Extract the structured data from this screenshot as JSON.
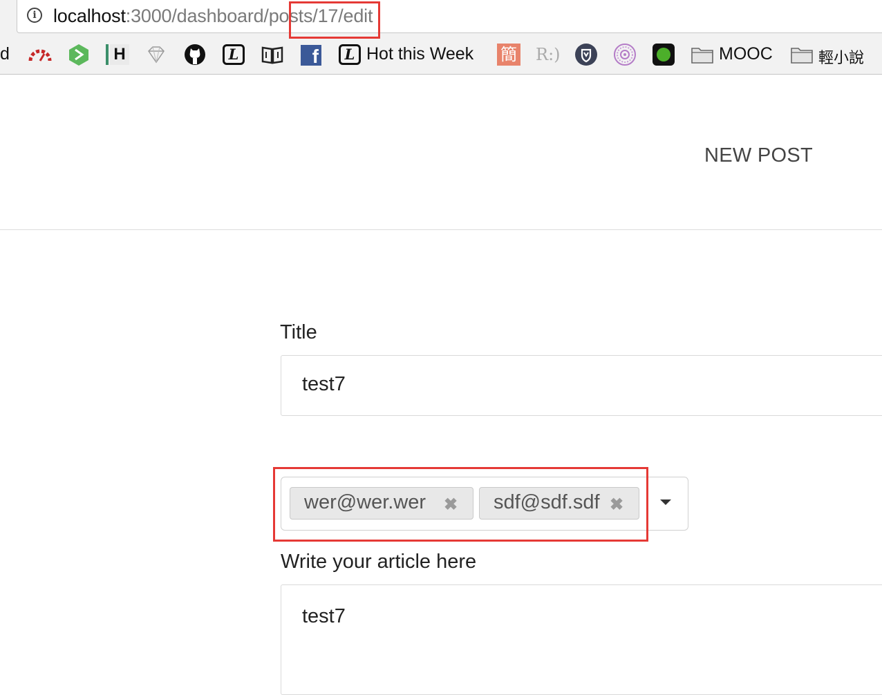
{
  "browser": {
    "url_host": "localhost",
    "url_path": ":3000/dashboard/posts/17/edit",
    "bookmarks": [
      {
        "icon": "truncated-d",
        "label": "d"
      },
      {
        "icon": "speedometer-icon"
      },
      {
        "icon": "green-hexagon-icon"
      },
      {
        "icon": "h-letter-icon",
        "glyph": "H"
      },
      {
        "icon": "diamond-icon"
      },
      {
        "icon": "github-icon"
      },
      {
        "icon": "l-letter-icon",
        "glyph": "L"
      },
      {
        "icon": "book-icon"
      },
      {
        "icon": "facebook-icon",
        "glyph": "f"
      },
      {
        "icon": "l-letter-icon",
        "glyph": "L",
        "label": "Hot this Week"
      },
      {
        "icon": "jian-char-icon",
        "glyph": "簡"
      },
      {
        "icon": "r-smile-icon",
        "glyph": "R:)"
      },
      {
        "icon": "shield-icon"
      },
      {
        "icon": "purple-circle-icon"
      },
      {
        "icon": "green-dot-icon"
      },
      {
        "icon": "folder-icon",
        "label": "MOOC"
      },
      {
        "icon": "folder-icon",
        "label": "輕小說"
      }
    ]
  },
  "nav": {
    "new_post": "NEW POST"
  },
  "form": {
    "title_label": "Title",
    "title_value": "test7",
    "tags": [
      {
        "label": "wer@wer.wer",
        "remove": "✖"
      },
      {
        "label": "sdf@sdf.sdf",
        "remove": "✖"
      }
    ],
    "article_label": "Write your article here",
    "article_value": "test7"
  },
  "colors": {
    "highlight": "#e53935",
    "facebook": "#3b5998",
    "github": "#111111"
  }
}
